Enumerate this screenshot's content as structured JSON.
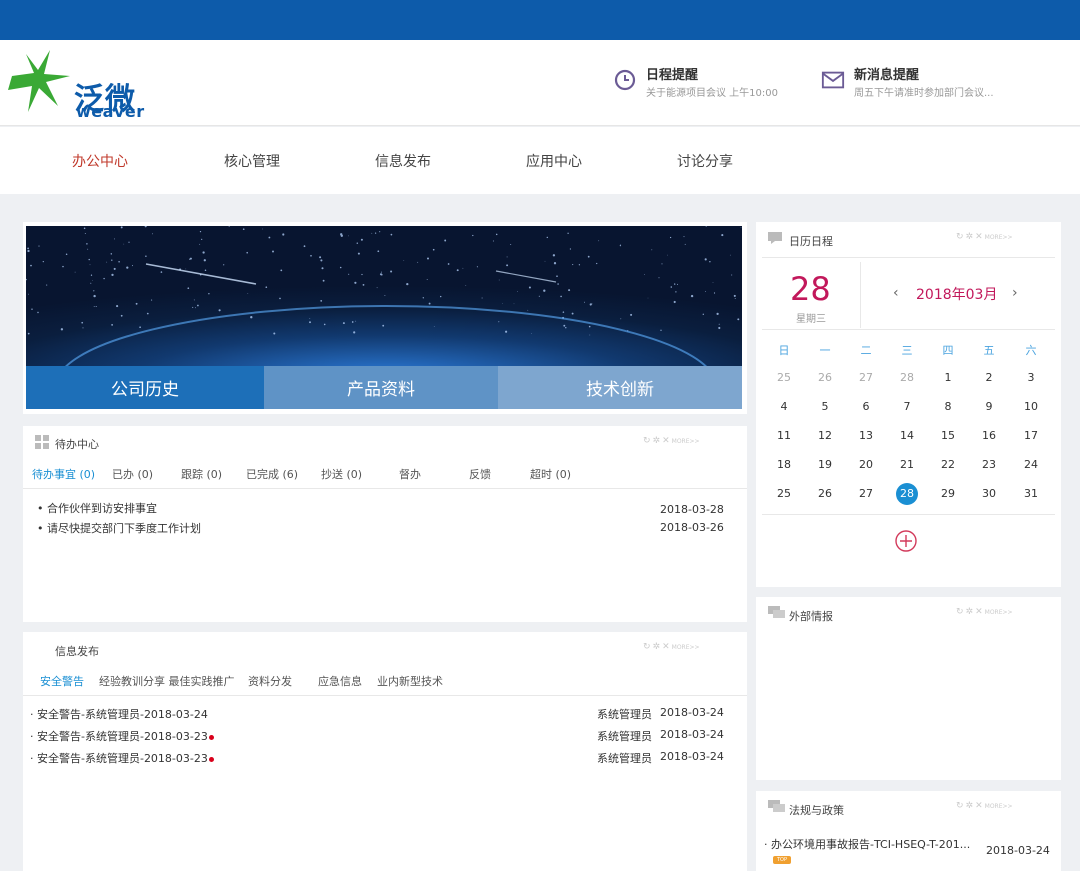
{
  "header": {
    "logo": {
      "name": "泛微",
      "sub": "weaver"
    },
    "schedule": {
      "title": "日程提醒",
      "subtitle": "关于能源项目会议  上午10:00"
    },
    "messages": {
      "title": "新消息提醒",
      "subtitle": "周五下午请准时参加部门会议..."
    }
  },
  "nav": {
    "items": [
      {
        "label": "办公中心",
        "active": true
      },
      {
        "label": "核心管理",
        "active": false
      },
      {
        "label": "信息发布",
        "active": false
      },
      {
        "label": "应用中心",
        "active": false
      },
      {
        "label": "讨论分享",
        "active": false
      }
    ]
  },
  "banner": {
    "tabs": [
      "公司历史",
      "产品资料",
      "技术创新"
    ]
  },
  "todo": {
    "title": "待办中心",
    "tabs": [
      "待办事宜 (0)",
      "已办 (0)",
      "跟踪 (0)",
      "已完成 (6)",
      "抄送 (0)",
      "督办",
      "反馈",
      "超时 (0)"
    ],
    "items": [
      {
        "text": "合作伙伴到访安排事宜",
        "date": "2018-03-28"
      },
      {
        "text": "请尽快提交部门下季度工作计划",
        "date": "2018-03-26"
      }
    ]
  },
  "info": {
    "title": "信息发布",
    "tabs": [
      "安全警告",
      "经验教训分享 最佳实践推广",
      "资料分发",
      "应急信息",
      "业内新型技术"
    ],
    "items": [
      {
        "text": "安全警告-系统管理员-2018-03-24",
        "author": "系统管理员",
        "date": "2018-03-24",
        "new": false
      },
      {
        "text": "安全警告-系统管理员-2018-03-23",
        "author": "系统管理员",
        "date": "2018-03-24",
        "new": true
      },
      {
        "text": "安全警告-系统管理员-2018-03-23",
        "author": "系统管理员",
        "date": "2018-03-24",
        "new": true
      }
    ]
  },
  "calendar": {
    "title": "日历日程",
    "day": "28",
    "weekday": "星期三",
    "month_label": "2018年03月",
    "weekdays": [
      "日",
      "一",
      "二",
      "三",
      "四",
      "五",
      "六"
    ],
    "weeks": [
      [
        "25",
        "26",
        "27",
        "28",
        "1",
        "2",
        "3"
      ],
      [
        "4",
        "5",
        "6",
        "7",
        "8",
        "9",
        "10"
      ],
      [
        "11",
        "12",
        "13",
        "14",
        "15",
        "16",
        "17"
      ],
      [
        "18",
        "19",
        "20",
        "21",
        "22",
        "23",
        "24"
      ],
      [
        "25",
        "26",
        "27",
        "28",
        "29",
        "30",
        "31"
      ]
    ],
    "today": "28",
    "colors": {
      "accent": "#1a8fd3",
      "day_number": "#c2185b"
    }
  },
  "external": {
    "title": "外部情报"
  },
  "policy": {
    "title": "法规与政策",
    "items": [
      {
        "text": "办公环境用事故报告-TCI-HSEQ-T-201...",
        "badge": "TOP",
        "date": "2018-03-24"
      }
    ]
  },
  "panel_more": "MORE>>"
}
